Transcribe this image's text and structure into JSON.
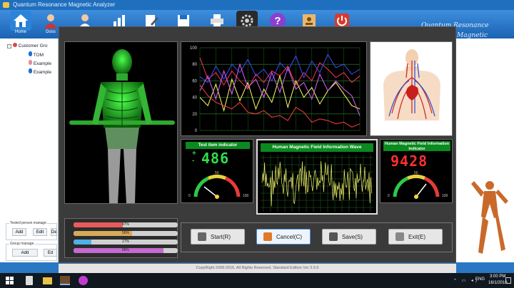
{
  "window": {
    "title": "Quantum Resonance Magnetic Analyzer"
  },
  "toolbar": {
    "home_label": "Home",
    "doss_label": "Doss"
  },
  "brand": {
    "line1": "Quantum Resonance",
    "line2": "Magnetic Analyzer"
  },
  "tree": {
    "root": "Customer Gro",
    "items": [
      "TOM",
      "Example",
      "Example"
    ]
  },
  "left_groups": {
    "tested_caption": "Tested person manage",
    "add_label": "Add",
    "edit_label": "Edit",
    "del_label": "Del",
    "group_caption": "Group manage",
    "group_add_label": "Add",
    "group_more_label": "Ed"
  },
  "dialog": {
    "test_item_title": "Test item indicator",
    "test_item_value": "486",
    "wave_title": "Human Magnetic Field Information Wave",
    "field_title": "Human Magnetic Field Information Indicator",
    "field_value": "9428",
    "gauge_min": "0",
    "gauge_mid": "50",
    "gauge_max": "100",
    "progress": [
      {
        "label": "47%",
        "value": 47,
        "color": "#e95b5b"
      },
      {
        "label": "56%",
        "value": 56,
        "color": "#d7aa58"
      },
      {
        "label": "17%",
        "value": 17,
        "color": "#4fb0e8"
      },
      {
        "label": "86%",
        "value": 86,
        "color": "#c56ad0"
      }
    ],
    "buttons": {
      "start": "Start(R)",
      "cancel": "Cancel(C)",
      "save": "Save(S)",
      "exit": "Exit(E)"
    }
  },
  "line_chart": {
    "y_ticks": [
      "0",
      "20",
      "40",
      "60",
      "80",
      "100"
    ]
  },
  "chart_data": {
    "type": "line",
    "title": "",
    "xlabel": "",
    "ylabel": "",
    "ylim": [
      0,
      100
    ],
    "grid": true,
    "x": [
      1,
      2,
      3,
      4,
      5,
      6,
      7,
      8,
      9,
      10,
      11,
      12,
      13,
      14,
      15,
      16,
      17,
      18,
      19,
      20,
      21
    ],
    "series": [
      {
        "color": "#ff3355",
        "values": [
          88,
          62,
          70,
          55,
          72,
          60,
          50,
          68,
          58,
          72,
          66,
          78,
          55,
          70,
          60,
          82,
          74,
          64,
          70,
          58,
          66
        ]
      },
      {
        "color": "#3b4dff",
        "values": [
          65,
          58,
          78,
          62,
          80,
          70,
          86,
          66,
          74,
          60,
          82,
          72,
          90,
          64,
          84,
          70,
          92,
          76,
          80,
          68,
          74
        ]
      },
      {
        "color": "#ffff66",
        "values": [
          40,
          30,
          56,
          24,
          62,
          36,
          58,
          26,
          50,
          34,
          66,
          28,
          60,
          40,
          52,
          32,
          48,
          58,
          44,
          30,
          26
        ]
      },
      {
        "color": "#e060ff",
        "values": [
          48,
          66,
          38,
          72,
          44,
          80,
          52,
          62,
          40,
          70,
          46,
          76,
          50,
          58,
          38,
          68,
          48,
          60,
          50,
          42,
          18
        ]
      },
      {
        "color": "#ff4040",
        "values": [
          55,
          42,
          34,
          30,
          26,
          34,
          22,
          20,
          24,
          16,
          18,
          12,
          28,
          22,
          10,
          14,
          12,
          8,
          10,
          4,
          8
        ]
      }
    ]
  },
  "status": {
    "copyright": "CopyRight 2008-2016, All Rights Reserved, Standard Edition Ver 3.9.9"
  },
  "taskbar": {
    "lang": "ENG",
    "time": "3:00 PM",
    "date": "16/1/2016"
  }
}
